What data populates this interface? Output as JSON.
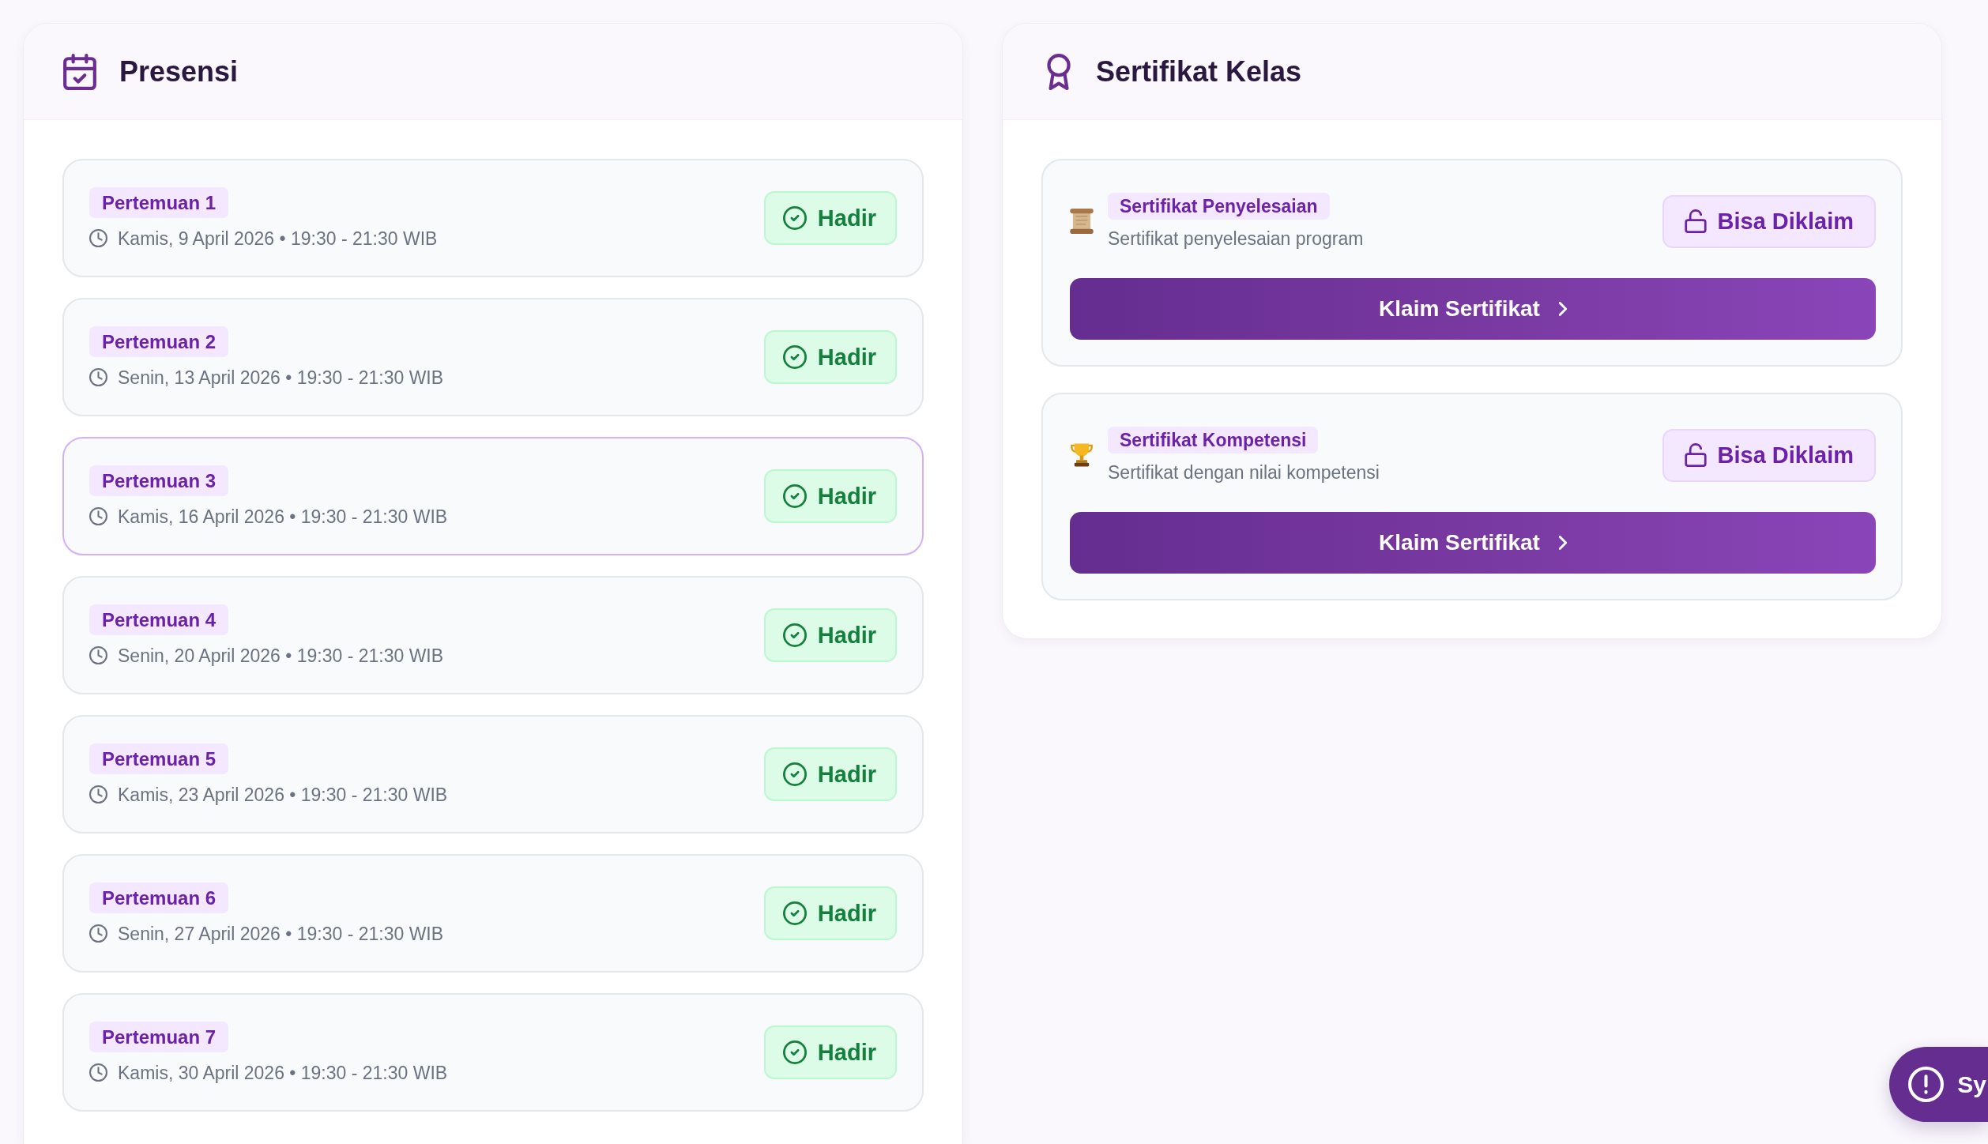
{
  "attendance_panel": {
    "title": "Presensi",
    "meetings": [
      {
        "label": "Pertemuan 1",
        "schedule": "Kamis, 9 April 2026 • 19:30 - 21:30 WIB",
        "status": "Hadir",
        "highlighted": false
      },
      {
        "label": "Pertemuan 2",
        "schedule": "Senin, 13 April 2026 • 19:30 - 21:30 WIB",
        "status": "Hadir",
        "highlighted": false
      },
      {
        "label": "Pertemuan 3",
        "schedule": "Kamis, 16 April 2026 • 19:30 - 21:30 WIB",
        "status": "Hadir",
        "highlighted": true
      },
      {
        "label": "Pertemuan 4",
        "schedule": "Senin, 20 April 2026 • 19:30 - 21:30 WIB",
        "status": "Hadir",
        "highlighted": false
      },
      {
        "label": "Pertemuan 5",
        "schedule": "Kamis, 23 April 2026 • 19:30 - 21:30 WIB",
        "status": "Hadir",
        "highlighted": false
      },
      {
        "label": "Pertemuan 6",
        "schedule": "Senin, 27 April 2026 • 19:30 - 21:30 WIB",
        "status": "Hadir",
        "highlighted": false
      },
      {
        "label": "Pertemuan 7",
        "schedule": "Kamis, 30 April 2026 • 19:30 - 21:30 WIB",
        "status": "Hadir",
        "highlighted": false
      }
    ]
  },
  "certificate_panel": {
    "title": "Sertifikat Kelas",
    "certificates": [
      {
        "kind": "scroll",
        "name": "Sertifikat Penyelesaian",
        "description": "Sertifikat penyelesaian program",
        "status": "Bisa Diklaim",
        "action": "Klaim Sertifikat"
      },
      {
        "kind": "trophy",
        "name": "Sertifikat Kompetensi",
        "description": "Sertifikat dengan nilai kompetensi",
        "status": "Bisa Diklaim",
        "action": "Klaim Sertifikat"
      }
    ]
  },
  "floating_button": {
    "label": "Sy"
  }
}
